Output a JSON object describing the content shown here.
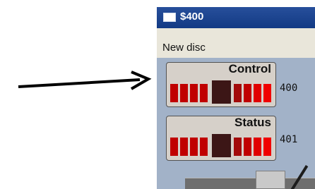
{
  "window": {
    "title": "$400"
  },
  "menu": {
    "items": [
      "New disc"
    ]
  },
  "indicators": [
    {
      "label": "Control",
      "value": "400"
    },
    {
      "label": "Status",
      "value": "401"
    }
  ],
  "colors": {
    "led_active": "#c00000",
    "led_dim": "#a30a0a",
    "led_bright": "#f00000",
    "led_center": "#3c1616",
    "titlebar": "#1c428c",
    "menubar": "#e9e6da",
    "content": "#a2b2c8"
  },
  "icons": [
    "arrow-icon",
    "window-icon"
  ]
}
